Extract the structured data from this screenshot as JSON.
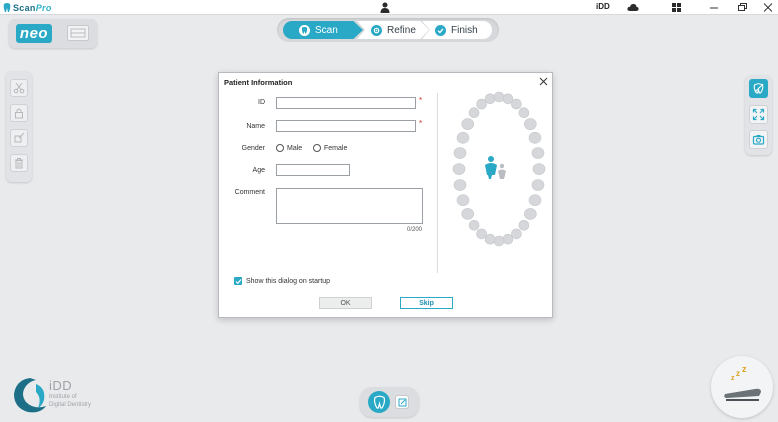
{
  "app": {
    "logo_main": "Scan",
    "logo_suffix": "Pro",
    "brand_short": "iDD"
  },
  "mode": {
    "active_label": "neo"
  },
  "steps": [
    {
      "label": "Scan",
      "active": true
    },
    {
      "label": "Refine",
      "active": false
    },
    {
      "label": "Finish",
      "active": false
    }
  ],
  "dialog": {
    "title": "Patient Information",
    "fields": {
      "id_label": "ID",
      "id_value": "",
      "name_label": "Name",
      "name_value": "",
      "gender_label": "Gender",
      "gender_options": [
        "Male",
        "Female"
      ],
      "age_label": "Age",
      "age_value": "",
      "comment_label": "Comment",
      "comment_value": "",
      "comment_counter": "0/200",
      "required_mark": "*"
    },
    "show_on_startup_label": "Show this dialog on startup",
    "show_on_startup_checked": true,
    "ok_label": "OK",
    "skip_label": "Skip"
  },
  "footer_logo": {
    "name": "iDD",
    "line1": "Institute of",
    "line2": "Digital Dentistry"
  },
  "colors": {
    "accent": "#2aa9c6",
    "background": "#e9eaec",
    "required": "#d9342b"
  }
}
